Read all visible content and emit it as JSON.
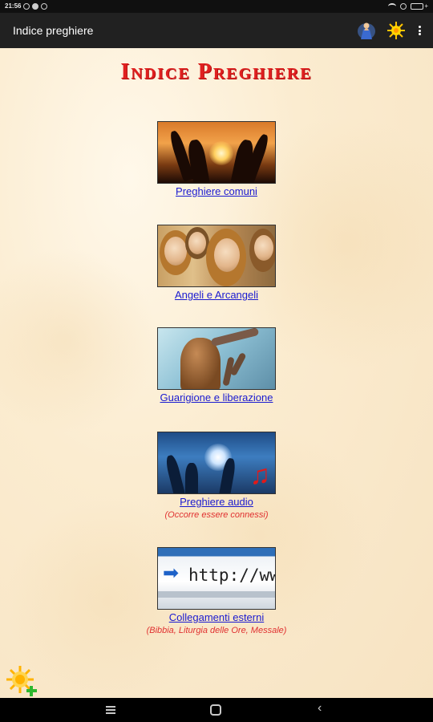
{
  "status_bar": {
    "time": "21:56",
    "battery_level": 0.8,
    "colors": {
      "battery": "#4caf50"
    }
  },
  "app_bar": {
    "title": "Indice preghiere",
    "actions": [
      {
        "icon": "praying-hands-icon"
      },
      {
        "icon": "sun-icon"
      },
      {
        "icon": "more-vert-icon"
      }
    ],
    "background": "#212121"
  },
  "heading": {
    "text": "Indice Preghiere",
    "color": "#e02020"
  },
  "menu": [
    {
      "icon": "hands-sunset-image",
      "label": "Preghiere comuni",
      "note": ""
    },
    {
      "icon": "angels-image",
      "label": "Angeli e Arcangeli",
      "note": ""
    },
    {
      "icon": "healing-image",
      "label": "Guarigione e liberazione",
      "note": ""
    },
    {
      "icon": "audio-prayer-image",
      "label": "Preghiere audio",
      "note": "(Occorre essere connessi)"
    },
    {
      "icon": "web-link-image",
      "label": "Collegamenti esterni",
      "note": "(Bibbia, Liturgia delle Ore, Messale)"
    }
  ],
  "colors": {
    "link": "#1a1ad0",
    "note": "#e03030",
    "background": "#fbecd0"
  },
  "fab": {
    "icon": "sun-add-icon"
  },
  "nav_bar": {
    "buttons": [
      {
        "icon": "recent-apps-icon"
      },
      {
        "icon": "home-icon"
      },
      {
        "icon": "back-icon"
      }
    ]
  }
}
